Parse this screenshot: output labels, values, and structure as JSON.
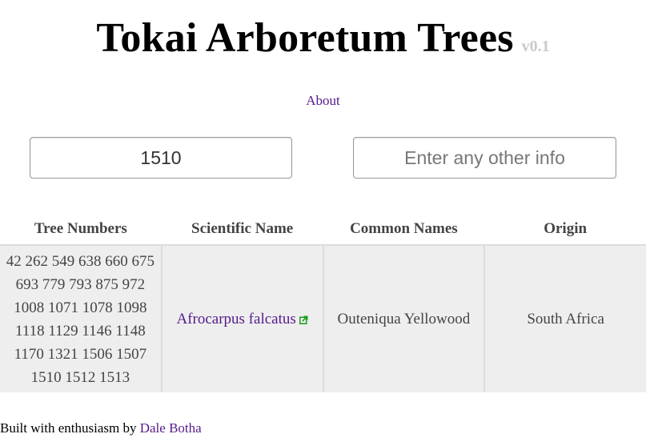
{
  "header": {
    "title": "Tokai Arboretum Trees",
    "version": "v0.1"
  },
  "nav": {
    "about_label": "About"
  },
  "search": {
    "tree_number_value": "1510",
    "other_info_placeholder": "Enter any other info"
  },
  "table": {
    "headers": [
      "Tree Numbers",
      "Scientific Name",
      "Common Names",
      "Origin"
    ],
    "rows": [
      {
        "tree_numbers": "42 262 549 638 660 675 693 779 793 875 972 1008 1071 1078 1098 1118 1129 1146 1148 1170 1321 1506 1507 1510 1512 1513",
        "scientific_name": "Afrocarpus falcatus",
        "common_names": "Outeniqua Yellowood",
        "origin": "South Africa"
      }
    ]
  },
  "footer": {
    "text": "Built with enthusiasm by ",
    "author": "Dale Botha"
  },
  "icons": {
    "external_link": "external-link-icon"
  },
  "colors": {
    "link": "#551a8b",
    "external_icon": "#1a9e1a",
    "row_background": "#eeeeee",
    "version": "#c9c9c9"
  }
}
